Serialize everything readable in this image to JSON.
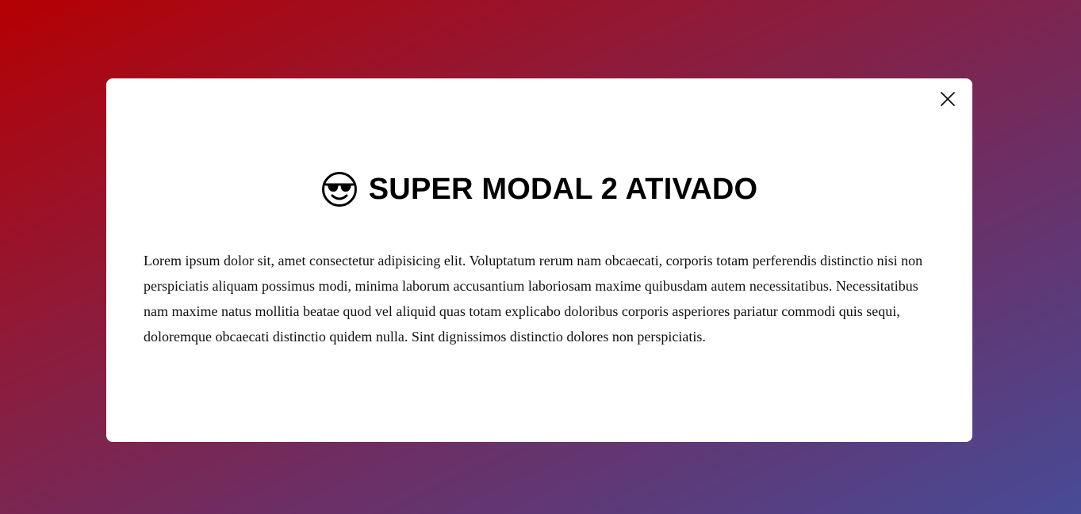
{
  "modal": {
    "title": "SUPER MODAL 2 ATIVADO",
    "title_icon": "cool-sunglasses-emoji-icon",
    "close_icon": "close-icon",
    "body": "Lorem ipsum dolor sit, amet consectetur adipisicing elit. Voluptatum rerum nam obcaecati, corporis totam perferendis distinctio nisi non perspiciatis aliquam possimus modi, minima laborum accusantium laboriosam maxime quibusdam autem necessitatibus. Necessitatibus nam maxime natus mollitia beatae quod vel aliquid quas totam explicabo doloribus corporis asperiores pariatur commodi quis sequi, doloremque obcaecati distinctio quidem nulla. Sint dignissimos distinctio dolores non perspiciatis."
  },
  "colors": {
    "background_start": "#b50003",
    "background_end": "#474b96",
    "modal_background": "#ffffff",
    "text": "#000000"
  }
}
